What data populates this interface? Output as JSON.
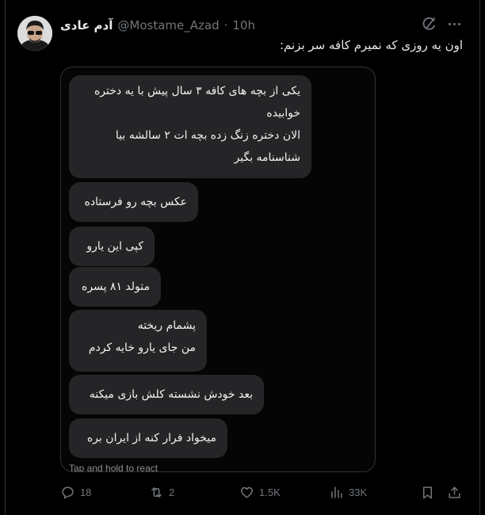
{
  "tweet": {
    "display_name": "آدم عادی",
    "handle": "@Mostame_Azad",
    "separator": "·",
    "time": "10h",
    "text": "اون یه روزی که نمیرم کافه سر بزنم:"
  },
  "chat": {
    "bubbles": [
      {
        "lines": [
          "یکی از بچه های کافه ۳ سال پیش با یه دختره",
          "خوابیده",
          "الان دختره زنگ زده بچه ات ۲ سالشه بیا",
          "شناسنامه بگیر"
        ]
      },
      {
        "lines": [
          "عکس بچه رو فرستاده"
        ]
      },
      {
        "lines": [
          "کپی این یارو"
        ]
      },
      {
        "lines": [
          "متولد ۸۱ پسره"
        ]
      },
      {
        "lines": [
          "پشمام ریخته",
          "من جای یارو خایه کردم"
        ]
      },
      {
        "lines": [
          "بعد خودش نشسته کلش بازی میکنه"
        ]
      },
      {
        "lines": [
          "میخواد فرار کنه از ایران بره"
        ]
      }
    ],
    "hint": "Tap and hold to react"
  },
  "actions": {
    "replies": "18",
    "reposts": "2",
    "likes": "1.5K",
    "views": "33K"
  }
}
